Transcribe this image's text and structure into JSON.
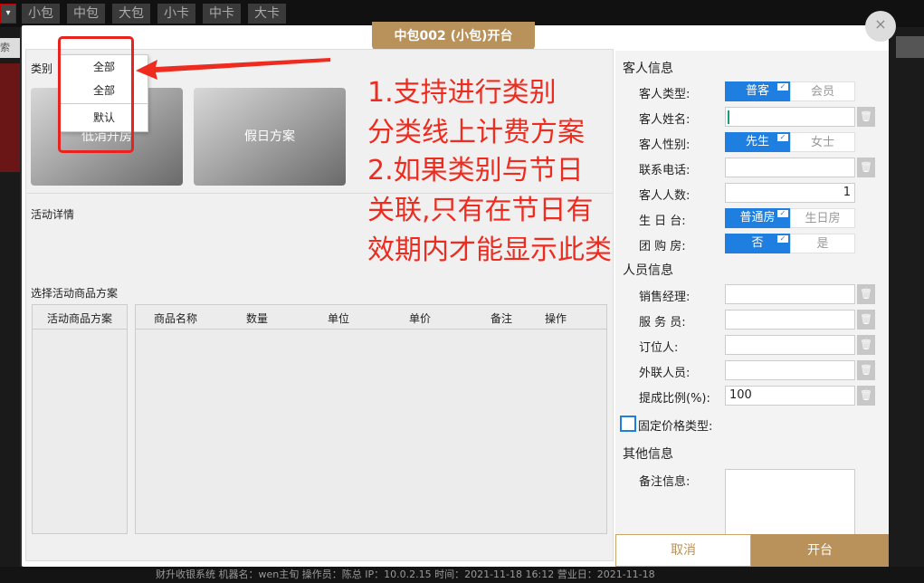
{
  "background": {
    "menu_glyph": "▾",
    "tabs": [
      "小包",
      "中包",
      "大包",
      "小卡",
      "中卡",
      "大卡"
    ],
    "left_input_text": "索",
    "status_bar": "财升收银系统    机器名：wen主旬   操作员：陈总   IP：10.0.2.15   时间：2021-11-18 16:12   营业日：2021-11-18"
  },
  "dialog": {
    "title": "中包002 (小包)开台",
    "close_glyph": "×"
  },
  "left": {
    "category_label": "类别",
    "dropdown_options": [
      "全部",
      "全部",
      "默认"
    ],
    "plans": [
      "低消开房",
      "假日方案"
    ],
    "activity_detail_label": "活动详情",
    "select_plan_label": "选择活动商品方案",
    "plan_list_header": "活动商品方案",
    "table_headers": [
      "商品名称",
      "数量",
      "单位",
      "单价",
      "备注",
      "操作"
    ]
  },
  "annotation": {
    "lines": [
      "1.支持进行类别",
      "分类线上计费方案",
      "2.如果类别与节日",
      "关联,只有在节日有",
      "效期内才能显示此类"
    ],
    "color": "#ee2b1f"
  },
  "guest": {
    "section_title": "客人信息",
    "type_label": "客人类型:",
    "type_options": [
      "普客",
      "会员"
    ],
    "name_label": "客人姓名:",
    "name_value": "",
    "gender_label": "客人性别:",
    "gender_options": [
      "先生",
      "女士"
    ],
    "phone_label": "联系电话:",
    "phone_value": "",
    "count_label": "客人人数:",
    "count_value": "1",
    "birthday_label": "生 日 台:",
    "birthday_options": [
      "普通房",
      "生日房"
    ],
    "group_label": "团 购 房:",
    "group_options": [
      "否",
      "是"
    ]
  },
  "staff": {
    "section_title": "人员信息",
    "rows": [
      {
        "label": "销售经理:",
        "value": ""
      },
      {
        "label": "服 务 员:",
        "value": ""
      },
      {
        "label": "订位人:",
        "value": ""
      },
      {
        "label": "外联人员:",
        "value": ""
      },
      {
        "label": "提成比例(%):",
        "value": "100"
      }
    ],
    "fixed_price_label": "固定价格类型:"
  },
  "other": {
    "section_title": "其他信息",
    "remark_label": "备注信息:"
  },
  "buttons": {
    "cancel": "取消",
    "open": "开台"
  },
  "colors": {
    "accent_gold": "#b8925a",
    "toggle_blue": "#1e7fe0",
    "highlight_red": "#e8231d"
  },
  "icons": {
    "trash": "trash-icon",
    "check": "check-icon"
  }
}
